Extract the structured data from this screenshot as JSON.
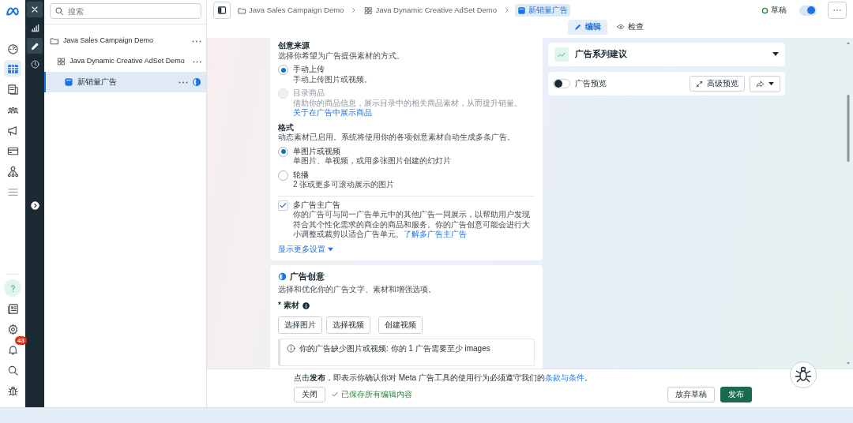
{
  "nav_rail": {
    "items": [
      {
        "kind": "dashboard",
        "selected": false
      },
      {
        "kind": "table",
        "selected": true
      },
      {
        "kind": "pages",
        "selected": false
      },
      {
        "kind": "people",
        "selected": false
      },
      {
        "kind": "megaphone",
        "selected": false
      },
      {
        "kind": "card",
        "selected": false
      },
      {
        "kind": "network",
        "selected": false
      },
      {
        "kind": "menu",
        "selected": false
      }
    ],
    "bottom_items": [
      {
        "kind": "help",
        "selected": true
      },
      {
        "kind": "news",
        "selected": false
      },
      {
        "kind": "settings",
        "selected": false
      },
      {
        "kind": "bell",
        "selected": false,
        "badge": "43"
      },
      {
        "kind": "search",
        "selected": false
      },
      {
        "kind": "bug",
        "selected": false
      }
    ]
  },
  "tool_rail": {
    "items": [
      {
        "kind": "chart",
        "selected": false
      },
      {
        "kind": "pencil",
        "selected": true
      },
      {
        "kind": "clock",
        "selected": false
      }
    ]
  },
  "tree": {
    "search": {
      "placeholder": "搜索"
    },
    "items": [
      {
        "kind": "campaign",
        "label": "Java Sales Campaign Demo",
        "selected": false,
        "children": [
          {
            "kind": "adset",
            "label": "Java Dynamic Creative AdSet Demo",
            "selected": false,
            "children": [
              {
                "kind": "ad",
                "label": "新销量广告",
                "selected": true
              }
            ]
          }
        ]
      }
    ]
  },
  "breadcrumbs": [
    {
      "kind": "campaign",
      "label": "Java Sales Campaign Demo",
      "selected": false
    },
    {
      "kind": "adset",
      "label": "Java Dynamic Creative AdSet Demo",
      "selected": false
    },
    {
      "kind": "ad",
      "label": "新销量广告",
      "selected": true
    }
  ],
  "status": {
    "label": "草稿",
    "on": true
  },
  "view_tabs": [
    {
      "kind": "edit",
      "label": "编辑",
      "selected": true
    },
    {
      "kind": "review",
      "label": "检查",
      "selected": false
    }
  ],
  "source_section": {
    "title": "创意来源",
    "description": "选择你希望为广告提供素材的方式。",
    "options": [
      {
        "label": "手动上传",
        "description": "手动上传图片或视频。",
        "selected": true,
        "disabled": false
      },
      {
        "label": "目录商品",
        "description": "借助你的商品信息，展示目录中的相关商品素材，从而提升销量。",
        "link": "关于在广告中展示商品",
        "selected": false,
        "disabled": true
      }
    ]
  },
  "format_section": {
    "title": "格式",
    "description": "动态素材已启用。系统将使用你的各项创意素材自动生成多条广告。",
    "options": [
      {
        "label": "单图片或视频",
        "description": "单图片、单视频，或用多张图片创建的幻灯片",
        "selected": true,
        "disabled": false
      },
      {
        "label": "轮播",
        "description": "2 张或更多可滚动展示的图片",
        "selected": false,
        "disabled": false
      }
    ]
  },
  "multi_advertiser": {
    "label": "多广告主广告",
    "checked": true,
    "description": "你的广告可与同一广告单元中的其他广告一同展示，以帮助用户发现符合其个性化需求的商企的商品和服务。你的广告创意可能会进行大小调整或裁剪以适合广告单元。",
    "link": "了解多广告主广告"
  },
  "show_more": "显示更多设置",
  "creative": {
    "title": "广告创意",
    "description": "选择和优化你的广告文字、素材和增强选项。",
    "media_label": "* 素材",
    "buttons": [
      "选择图片",
      "选择视频",
      "创建视频"
    ],
    "warning": "你的广告缺少图片或视频: 你的 1 广告需要至少 images"
  },
  "suggestions": {
    "title": "广告系列建议"
  },
  "preview": {
    "label": "广告预览",
    "on": false,
    "button": "高级预览"
  },
  "footer": {
    "notice": "点击**发布**，即表示你确认你对 Meta 广告工具的使用行为必须遵守我们的",
    "link": "条款与条件",
    "notice_end": "。",
    "close": "关闭",
    "saved": "已保存所有编辑内容",
    "discard": "放弃草稿",
    "publish": "发布"
  }
}
